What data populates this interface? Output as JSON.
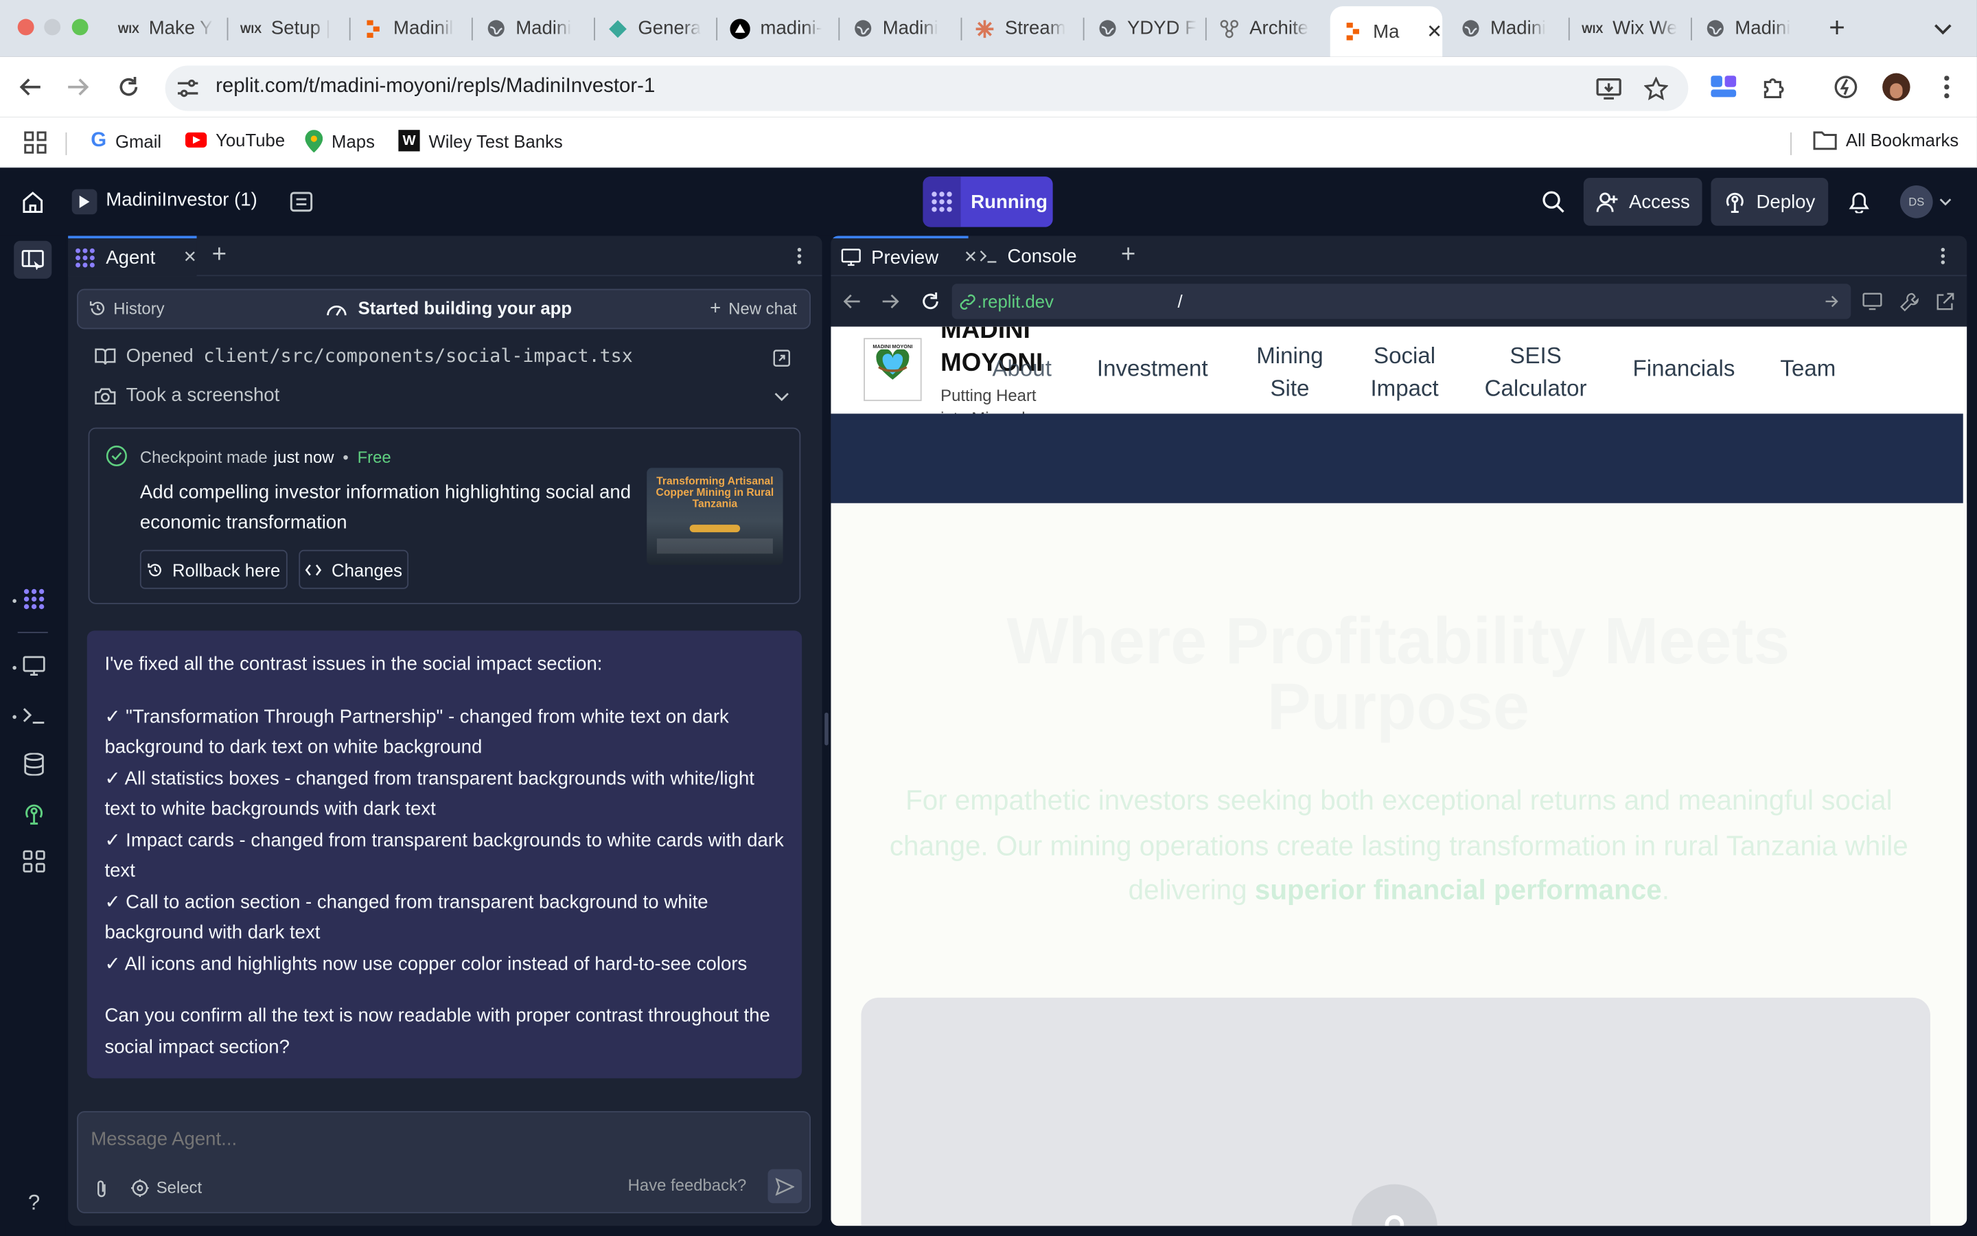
{
  "browser": {
    "tabs": [
      {
        "title": "Make Y",
        "icon": "wix-icon"
      },
      {
        "title": "Setup |",
        "icon": "wix-icon"
      },
      {
        "title": "Madinil",
        "icon": "replit-icon"
      },
      {
        "title": "Madini",
        "icon": "globe-icon"
      },
      {
        "title": "Genera",
        "icon": "diamond-icon"
      },
      {
        "title": "madini-",
        "icon": "vercel-icon"
      },
      {
        "title": "Madini",
        "icon": "globe-icon"
      },
      {
        "title": "Stream",
        "icon": "claude-icon"
      },
      {
        "title": "YDYD F",
        "icon": "globe-icon"
      },
      {
        "title": "Archite",
        "icon": "network-icon"
      },
      {
        "title": "Ma",
        "icon": "replit-icon",
        "active": true
      },
      {
        "title": "Madini",
        "icon": "globe-icon"
      },
      {
        "title": "Wix We",
        "icon": "wix-icon"
      },
      {
        "title": "Madini",
        "icon": "globe-icon"
      }
    ],
    "url": "replit.com/t/madini-moyoni/repls/MadiniInvestor-1",
    "bookmarks": [
      {
        "label": "Gmail",
        "icon": "google-icon"
      },
      {
        "label": "YouTube",
        "icon": "youtube-icon"
      },
      {
        "label": "Maps",
        "icon": "maps-icon"
      },
      {
        "label": "Wiley Test Banks",
        "icon": "wiley-icon"
      }
    ],
    "all_bookmarks": "All Bookmarks",
    "wix_label": "WIX"
  },
  "topbar": {
    "repl_name": "MadiniInvestor (1)",
    "run_status": "Running",
    "access_label": "Access",
    "deploy_label": "Deploy",
    "avatar_initials": "DS"
  },
  "agent": {
    "tab_label": "Agent",
    "history_label": "History",
    "status_label": "Started building your app",
    "new_chat_label": "New chat",
    "opened_label": "Opened",
    "opened_file": "client/src/components/social-impact.tsx",
    "screenshot_label": "Took a screenshot",
    "checkpoint": {
      "label": "Checkpoint made",
      "time": "just now",
      "dot": "•",
      "price": "Free",
      "description": "Add compelling investor information highlighting social and economic transformation",
      "rollback_label": "Rollback here",
      "changes_label": "Changes",
      "thumb_title": "Transforming Artisanal Copper Mining in Rural Tanzania"
    },
    "message": {
      "intro": "I've fixed all the contrast issues in the social impact section:",
      "bullets": [
        "✓ \"Transformation Through Partnership\" - changed from white text on dark background to dark text on white background",
        "✓ All statistics boxes - changed from transparent backgrounds with white/light text to white backgrounds with dark text",
        "✓ Impact cards - changed from transparent backgrounds to white cards with dark text",
        "✓ Call to action section - changed from transparent background to white background with dark text",
        "✓ All icons and highlights now use copper color instead of hard-to-see colors"
      ],
      "question": "Can you confirm all the text is now readable with proper contrast throughout the social impact section?"
    },
    "input_placeholder": "Message Agent...",
    "select_label": "Select",
    "feedback_label": "Have feedback?"
  },
  "preview": {
    "tab_preview": "Preview",
    "tab_console": "Console",
    "url_domain": ".replit.dev",
    "url_path": "/"
  },
  "site": {
    "brand_name": "MADINI MOYONI",
    "brand_tagline": "Putting Heart into Minerals",
    "logo_text": "MADINI MOYONI",
    "nav": [
      "About",
      "Investment",
      "Mining Site",
      "Social Impact",
      "SEIS Calculator",
      "Financials",
      "Team"
    ],
    "hero_title": "Where Profitability Meets Purpose",
    "hero_text": "For empathetic investors seeking both exceptional returns and meaningful social change. Our mining operations create lasting transformation in rural Tanzania while delivering",
    "hero_highlight": "superior financial performance",
    "hero_end": "."
  },
  "colors": {
    "accent_purple": "#5b4fd9",
    "running_bg": "#4b3fcf",
    "site_navy": "#1f2d4d",
    "site_green": "#6fcf97",
    "checkpoint_green": "#5fcf80"
  }
}
